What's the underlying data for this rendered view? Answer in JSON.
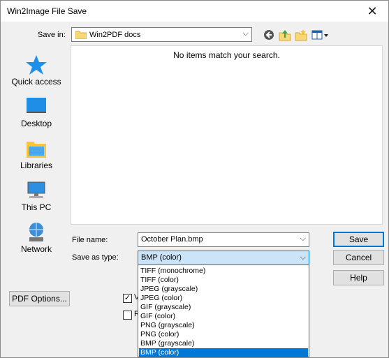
{
  "window": {
    "title": "Win2Image File Save",
    "close_glyph": "✕"
  },
  "toolbar": {
    "save_in_label": "Save in:",
    "folder": "Win2PDF docs",
    "icons": [
      "back-icon",
      "up-folder-icon",
      "new-folder-icon",
      "view-menu-icon"
    ]
  },
  "places": [
    {
      "label": "Quick access",
      "icon": "star-icon"
    },
    {
      "label": "Desktop",
      "icon": "desktop-icon"
    },
    {
      "label": "Libraries",
      "icon": "libraries-icon"
    },
    {
      "label": "This PC",
      "icon": "computer-icon"
    },
    {
      "label": "Network",
      "icon": "network-icon"
    }
  ],
  "file_list": {
    "empty_message": "No items match your search."
  },
  "form": {
    "file_name_label": "File name:",
    "file_name_value": "October Plan.bmp",
    "save_type_label": "Save as type:",
    "save_type_value": "BMP (color)"
  },
  "buttons": {
    "save": "Save",
    "cancel": "Cancel",
    "help": "Help",
    "pdf_options": "PDF Options..."
  },
  "checkboxes": [
    {
      "label": "V",
      "checked": true
    },
    {
      "label": "R",
      "checked": false
    }
  ],
  "file_types": [
    "TIFF (monochrome)",
    "TIFF (color)",
    "JPEG (grayscale)",
    "JPEG (color)",
    "GIF (grayscale)",
    "GIF (color)",
    "PNG (grayscale)",
    "PNG (color)",
    "BMP (grayscale)",
    "BMP (color)"
  ],
  "selected_type_index": 9,
  "colors": {
    "accent": "#0078d7",
    "selection_bg": "#cce4f7"
  }
}
